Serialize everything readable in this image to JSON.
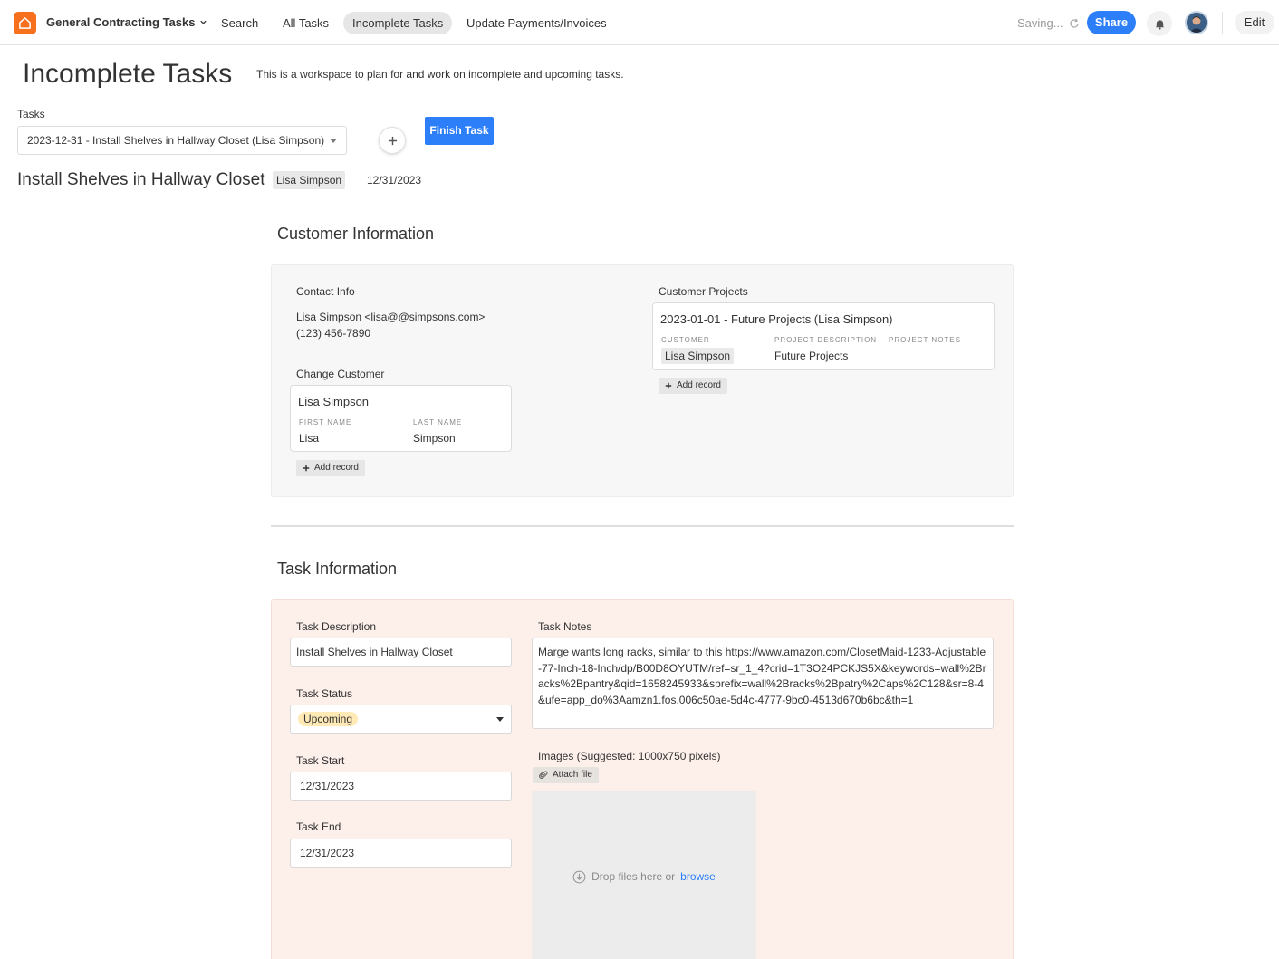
{
  "app": {
    "name": "General Contracting Tasks",
    "brand_color": "#f6701e",
    "accent_color": "#2d7ff9"
  },
  "nav": {
    "tabs": [
      {
        "label": "Search"
      },
      {
        "label": "All Tasks"
      },
      {
        "label": "Incomplete Tasks",
        "active": true
      },
      {
        "label": "Update Payments/Invoices"
      }
    ]
  },
  "topbar": {
    "saving": "Saving...",
    "share": "Share",
    "edit": "Edit"
  },
  "page": {
    "title": "Incomplete Tasks",
    "description": "This is a workspace to plan for and work on incomplete and upcoming tasks."
  },
  "tasks": {
    "label": "Tasks",
    "selected": "2023-12-31 - Install Shelves in Hallway Closet (Lisa Simpson)",
    "finish_button": "Finish Task"
  },
  "record": {
    "title": "Install Shelves in Hallway Closet",
    "customer": "Lisa Simpson",
    "date": "12/31/2023"
  },
  "customer_section": {
    "title": "Customer Information",
    "contact_label": "Contact Info",
    "contact_line1": "Lisa Simpson <lisa@@simpsons.com>",
    "contact_line2": "(123) 456-7890",
    "change_label": "Change Customer",
    "customer_card": {
      "title": "Lisa Simpson",
      "first_name_label": "FIRST NAME",
      "first_name": "Lisa",
      "last_name_label": "LAST NAME",
      "last_name": "Simpson"
    },
    "add_record": "Add record",
    "projects_label": "Customer Projects",
    "project_card": {
      "title": "2023-01-01 - Future Projects (Lisa Simpson)",
      "customer_label": "CUSTOMER",
      "customer": "Lisa Simpson",
      "description_label": "PROJECT DESCRIPTION",
      "description": "Future Projects",
      "notes_label": "PROJECT NOTES"
    },
    "project_add_record": "Add record"
  },
  "task_section": {
    "title": "Task Information",
    "description_label": "Task Description",
    "description_value": "Install Shelves in Hallway Closet",
    "status_label": "Task Status",
    "status_value": "Upcoming",
    "start_label": "Task Start",
    "start_value": "12/31/2023",
    "end_label": "Task End",
    "end_value": "12/31/2023",
    "notes_label": "Task Notes",
    "notes_value": "Marge wants long racks, similar to this https://www.amazon.com/ClosetMaid-1233-Adjustable-77-Inch-18-Inch/dp/B00D8OYUTM/ref=sr_1_4?crid=1T3O24PCKJS5X&keywords=wall%2Bracks%2Bpantry&qid=1658245933&sprefix=wall%2Bracks%2Bpatry%2Caps%2C128&sr=8-4&ufe=app_do%3Aamzn1.fos.006c50ae-5d4c-4777-9bc0-4513d670b6bc&th=1",
    "images_label": "Images (Suggested: 1000x750 pixels)",
    "attach_file": "Attach file",
    "drop_text": "Drop files here or",
    "browse": "browse"
  }
}
